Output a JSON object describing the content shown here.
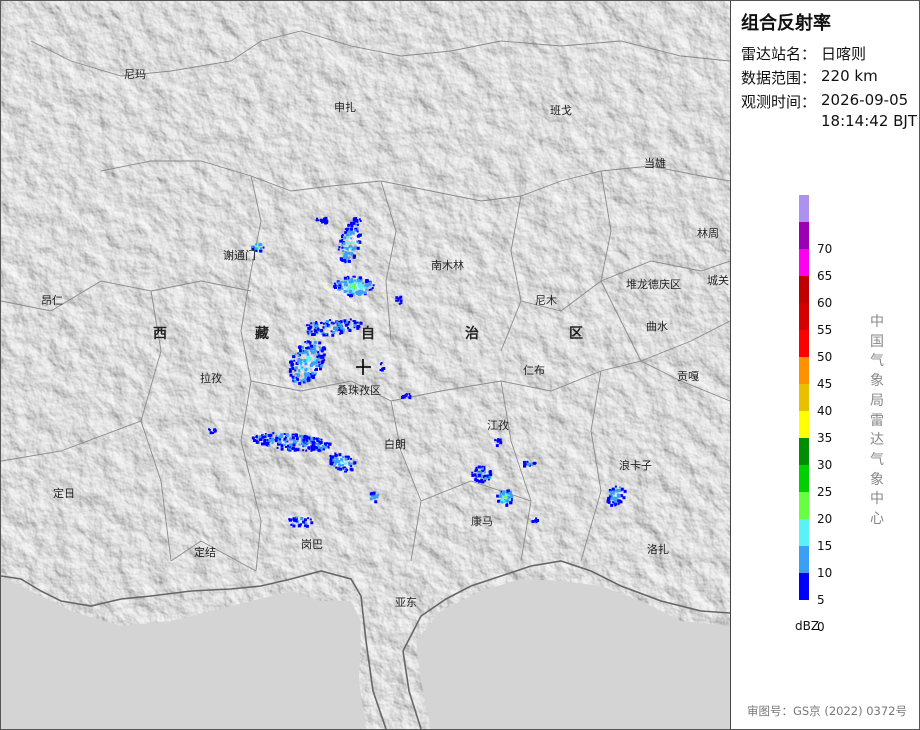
{
  "panel": {
    "title": "组合反射率",
    "station_label": "雷达站名：",
    "station_value": "日喀则",
    "range_label": "数据范围：",
    "range_value": "220 km",
    "time_label": "观测时间：",
    "time_date": "2026-09-05",
    "time_clock": "18:14:42 BJT",
    "vertical_label": "中国气象局雷达气象中心",
    "approval": "审图号：GS京 (2022) 0372号"
  },
  "legend": {
    "unit": "dBZ",
    "bins": [
      {
        "label": "",
        "color": "#ad90f0"
      },
      {
        "label": "70",
        "color": "#9b00b5"
      },
      {
        "label": "65",
        "color": "#ff00f0"
      },
      {
        "label": "60",
        "color": "#c00000"
      },
      {
        "label": "55",
        "color": "#d60000"
      },
      {
        "label": "50",
        "color": "#ff0000"
      },
      {
        "label": "45",
        "color": "#ff9000"
      },
      {
        "label": "40",
        "color": "#e7c000"
      },
      {
        "label": "35",
        "color": "#ffff00"
      },
      {
        "label": "30",
        "color": "#008e00"
      },
      {
        "label": "25",
        "color": "#00d000"
      },
      {
        "label": "20",
        "color": "#66ff44"
      },
      {
        "label": "15",
        "color": "#5af3f3"
      },
      {
        "label": "10",
        "color": "#3ba0f5"
      },
      {
        "label": "5",
        "color": "#0000ff"
      },
      {
        "label": "0",
        "color": ""
      }
    ]
  },
  "map": {
    "places": [
      "尼玛",
      "申扎",
      "班戈",
      "当雄",
      "林周",
      "谢通门",
      "南木林",
      "昂仁",
      "尼木",
      "堆龙德庆区",
      "城关区",
      "曲水",
      "拉孜",
      "桑珠孜区",
      "仁布",
      "贡嘎",
      "江孜",
      "浪卡子",
      "白朗",
      "康马",
      "定日",
      "定结",
      "岗巴",
      "亚东",
      "洛扎"
    ],
    "region": [
      "西",
      "藏",
      "自",
      "治",
      "区"
    ]
  }
}
